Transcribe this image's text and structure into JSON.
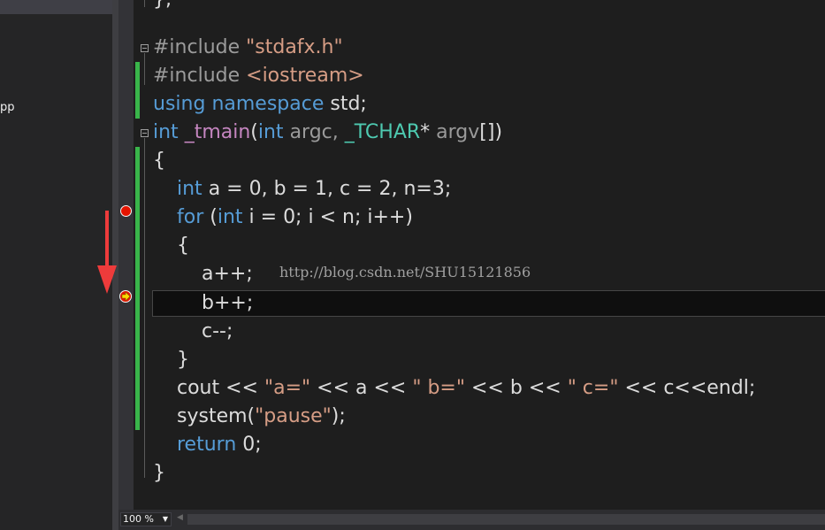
{
  "sidebar": {
    "file_label": "pp"
  },
  "code": {
    "line0": "};",
    "include1_kw": "#include",
    "include1_path": "\"stdafx.h\"",
    "include2_kw": "#include",
    "include2_path": "<iostream>",
    "using": "using",
    "namespace": "namespace",
    "std": "std;",
    "int1": "int",
    "tmain": "_tmain",
    "paren_open": "(",
    "int2": "int",
    "argc": "argc,",
    "tchar": "_TCHAR",
    "star": "*",
    "argv": "argv",
    "sig_close": "[])",
    "brace_open": "{",
    "decl_int": "int",
    "decl_rest": "a = 0, b = 1, c = 2, n=3;",
    "for_kw": "for",
    "for_open": "(",
    "for_int": "int",
    "for_rest": "i = 0; i < n; i++)",
    "inner_open": "{",
    "a_inc": "a++;",
    "b_inc": "b++;",
    "c_dec": "c--;",
    "inner_close": "}",
    "cout_part1": "cout <<",
    "str_a": "\"a=\"",
    "cout_part2": "<< a <<",
    "str_b": "\" b=\"",
    "cout_part3": "<< b <<",
    "str_c": "\" c=\"",
    "cout_part4": "<< c<<endl;",
    "system_part1": "system(",
    "str_pause": "\"pause\"",
    "system_part2": ");",
    "return_kw": "return",
    "return_rest": "0;",
    "brace_close": "}"
  },
  "watermark": "http://blog.csdn.net/SHU15121856",
  "statusbar": {
    "zoom": "100 %"
  },
  "colors": {
    "keyword": "#569cd6",
    "string": "#d69d85",
    "type": "#4ec9b0",
    "function": "#c586c0",
    "breakpoint": "#e51400",
    "change_bar": "#39b54a",
    "annotation_arrow": "#ee3b3b"
  },
  "icons": [
    "breakpoint-icon",
    "execution-pointer-icon",
    "down-arrow-annotation",
    "collapse-icon"
  ]
}
